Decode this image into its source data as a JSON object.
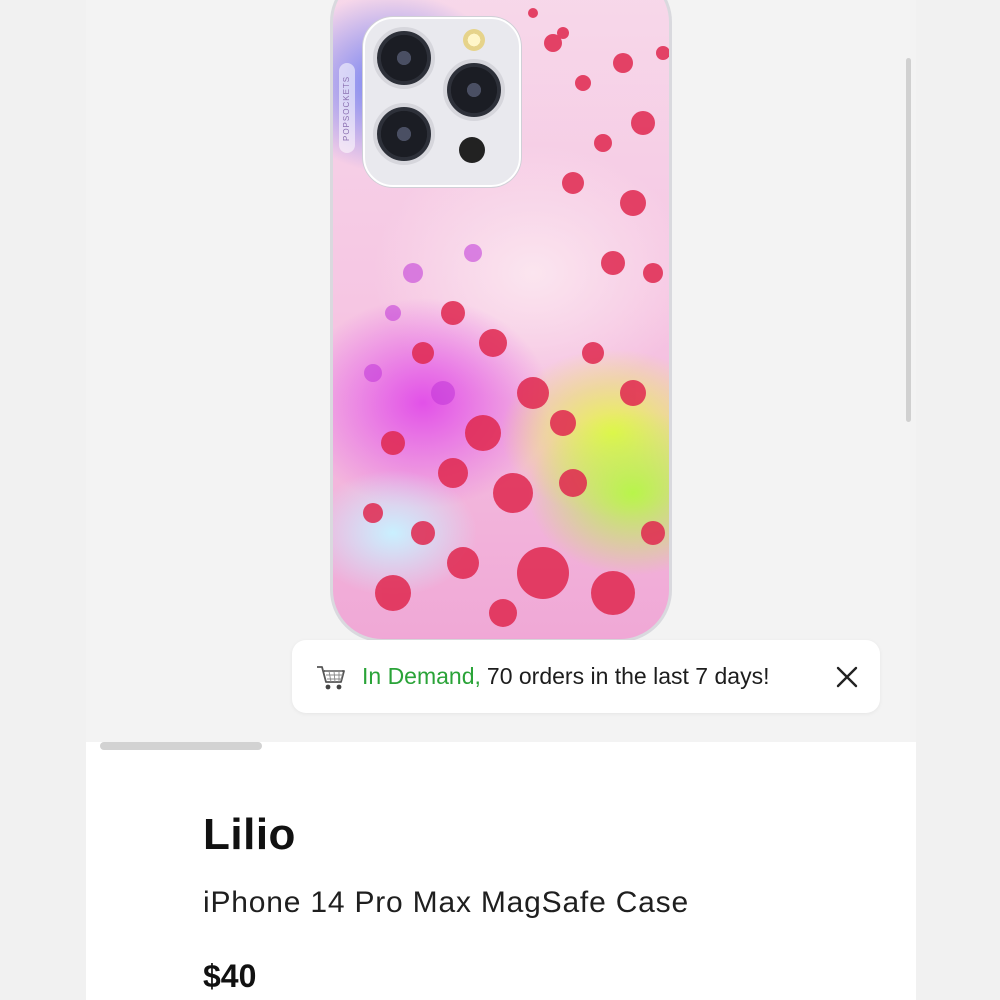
{
  "product_image": {
    "brand_text": "POPSOCKETS"
  },
  "notice": {
    "highlight": "In Demand,",
    "message": "70 orders in the last 7 days!",
    "icon": "cart-icon",
    "close_icon": "close-icon",
    "highlight_color": "#2aa338"
  },
  "product": {
    "name": "Lilio",
    "description": "iPhone 14 Pro Max MagSafe Case",
    "price": "$40"
  }
}
